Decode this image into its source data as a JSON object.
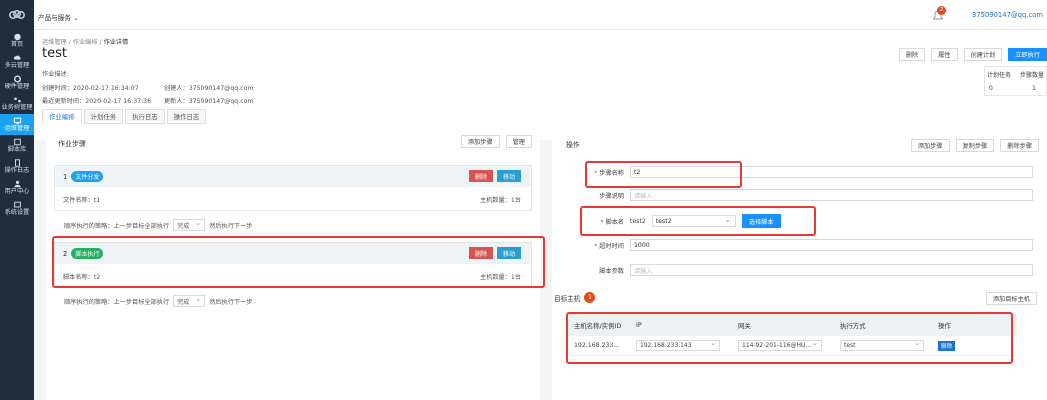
{
  "sidebar": {
    "items": [
      {
        "label": "首页",
        "icon": "info-icon"
      },
      {
        "label": "多云管理",
        "icon": "cloud-icon"
      },
      {
        "label": "硬件管理",
        "icon": "gear-icon"
      },
      {
        "label": "业务树管理",
        "icon": "tree-icon"
      },
      {
        "label": "运维管理",
        "icon": "monitor-icon"
      },
      {
        "label": "脚本库",
        "icon": "script-icon"
      },
      {
        "label": "操作日志",
        "icon": "log-icon"
      },
      {
        "label": "用户中心",
        "icon": "user-icon"
      },
      {
        "label": "系统设置",
        "icon": "settings-icon"
      }
    ],
    "active_color": "#1aa1f0"
  },
  "topbar": {
    "product_menu": "产品与服务",
    "notification_count": "2",
    "user_email": "375090147@qq.com"
  },
  "header": {
    "breadcrumb": [
      "运维管理",
      "作业编排",
      "作业详情"
    ],
    "title": "test",
    "actions": [
      "删除",
      "履性",
      "创建计划",
      "立即执行"
    ],
    "meta": {
      "desc_label": "作业描述:",
      "created_time": "创建时间：2020-02-17 16:34:07",
      "creator": "创建人：375090147@qq.com",
      "updated_time": "最近更新时间：2020-02-17 16:37:36",
      "updater": "更新人：375090147@qq.com"
    },
    "stats": {
      "col1": "计划任务",
      "col2": "步骤数量",
      "val1": "0",
      "val2": "1"
    },
    "tabs": [
      "作业编排",
      "计划任务",
      "执行日志",
      "操作日志"
    ]
  },
  "left_panel": {
    "title": "作业步骤",
    "actions": [
      "添加步骤",
      "管理"
    ],
    "delete_label": "删除",
    "move_label": "移动",
    "steps": [
      {
        "num": "1",
        "tag": "文件分发",
        "detail": "文件名称：t1",
        "hosts": "主机数量：1台"
      },
      {
        "num": "2",
        "tag": "脚本执行",
        "detail": "脚本名称：t2",
        "hosts": "主机数量：1台"
      }
    ],
    "strategy": {
      "prefix": "顺序执行的策略：上一步目标全部执行",
      "value": "完成",
      "suffix": "然后执行下一步"
    }
  },
  "right_panel": {
    "title": "操作",
    "actions": [
      "添加步骤",
      "复制步骤",
      "删除步骤"
    ],
    "fields": {
      "step_name_label": "步骤名称",
      "step_name_value": "t2",
      "step_desc_label": "步骤说明",
      "step_desc_placeholder": "请输入",
      "script_label": "脚本名",
      "script_name": "test2",
      "script_select": "test2",
      "choose_script": "选择脚本",
      "timeout_label": "超时时间",
      "timeout_value": "1000",
      "params_label": "脚本参数",
      "params_placeholder": "请输入"
    },
    "target": {
      "title": "目标主机",
      "count": "1",
      "add_button": "添加目标主机",
      "columns": [
        "主机名称/实例ID",
        "IP",
        "网关",
        "执行方式",
        "操作"
      ],
      "rows": [
        {
          "host": "192.168.233...",
          "ip": "192.168.233.143",
          "gateway": "114-92-201-116@HU...",
          "method": "test",
          "action": "删除"
        }
      ]
    }
  },
  "colors": {
    "primary": "#1890ff",
    "danger": "#d9534f",
    "annotation": "#e53935"
  }
}
